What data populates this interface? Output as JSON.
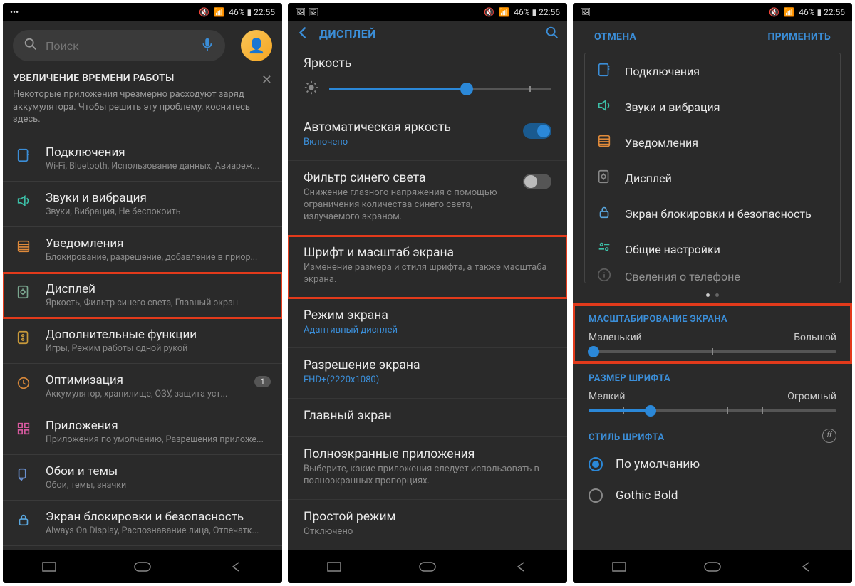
{
  "screen1": {
    "status": {
      "left_icons": "•••",
      "right": "46% ▮ 22:55"
    },
    "search_placeholder": "Поиск",
    "tip": {
      "title": "УВЕЛИЧЕНИЕ ВРЕМЕНИ РАБОТЫ",
      "body": "Некоторые приложения чрезмерно расходуют заряд аккумулятора. Чтобы решить эту проблему, коснитесь здесь."
    },
    "items": [
      {
        "icon": "connections",
        "title": "Подключения",
        "sub": "Wi-Fi, Bluetooth, Использование данных, Авиареж...",
        "hl": false
      },
      {
        "icon": "sound",
        "title": "Звуки и вибрация",
        "sub": "Звуки, Вибрация, Не беспокоить",
        "hl": false
      },
      {
        "icon": "notif",
        "title": "Уведомления",
        "sub": "Блокирование, разрешение, добавление в приор...",
        "hl": false
      },
      {
        "icon": "display",
        "title": "Дисплей",
        "sub": "Яркость, Фильтр синего света, Главный экран",
        "hl": true
      },
      {
        "icon": "advanced",
        "title": "Дополнительные функции",
        "sub": "Игры, Режим работы одной рукой",
        "hl": false
      },
      {
        "icon": "optim",
        "title": "Оптимизация",
        "sub": "Аккумулятор, хранилище, ОЗУ, защита уст...",
        "hl": false,
        "badge": "1"
      },
      {
        "icon": "apps",
        "title": "Приложения",
        "sub": "Приложения по умолчанию, Разрешения приложе...",
        "hl": false
      },
      {
        "icon": "wallpaper",
        "title": "Обои и темы",
        "sub": "Обои, темы, значки",
        "hl": false
      },
      {
        "icon": "lock",
        "title": "Экран блокировки и безопасность",
        "sub": "Always On Display, Распознавание лица, Отпечатк...",
        "hl": false
      }
    ]
  },
  "screen2": {
    "status": {
      "right": "46% ▮ 22:56"
    },
    "appbar_title": "ДИСПЛЕЙ",
    "brightness": {
      "title": "Яркость",
      "value": 62
    },
    "auto_bright": {
      "title": "Автоматическая яркость",
      "sub": "Включено",
      "on": true
    },
    "blue_filter": {
      "title": "Фильтр синего света",
      "sub": "Снижение глазного напряжения с помощью ограничения количества синего света, излучаемого экраном.",
      "on": false
    },
    "font_scale": {
      "title": "Шрифт и масштаб экрана",
      "sub": "Изменение размера и стиля шрифта, а также масштаба экрана."
    },
    "screen_mode": {
      "title": "Режим экрана",
      "sub": "Адаптивный дисплей"
    },
    "resolution": {
      "title": "Разрешение экрана",
      "sub": "FHD+(2220x1080)"
    },
    "home": {
      "title": "Главный экран"
    },
    "fullscreen": {
      "title": "Полноэкранные приложения",
      "sub": "Выберите, какие приложения следует использовать в полноэкранных пропорциях."
    },
    "simple": {
      "title": "Простой режим",
      "sub": "Отключено"
    }
  },
  "screen3": {
    "status": {
      "right": "46% ▮ 22:56"
    },
    "cancel": "ОТМЕНА",
    "apply": "ПРИМЕНИТЬ",
    "cats": [
      {
        "icon": "connections",
        "label": "Подключения",
        "color": "#3b8ed8"
      },
      {
        "icon": "sound",
        "label": "Звуки и вибрация",
        "color": "#3cc0a8"
      },
      {
        "icon": "notif",
        "label": "Уведомления",
        "color": "#e08a3a"
      },
      {
        "icon": "display",
        "label": "Дисплей",
        "color": "#888"
      },
      {
        "icon": "lock",
        "label": "Экран блокировки и безопасность",
        "color": "#5aa8e0"
      },
      {
        "icon": "general",
        "label": "Общие настройки",
        "color": "#3cc0a8"
      },
      {
        "icon": "about",
        "label": "Свеления о телефоне",
        "color": "#888"
      }
    ],
    "scale": {
      "head": "МАСШТАБИРОВАНИЕ ЭКРАНА",
      "min": "Маленький",
      "max": "Большой",
      "value": 2
    },
    "font": {
      "head": "РАЗМЕР ШРИФТА",
      "min": "Мелкий",
      "max": "Огромный",
      "value": 25
    },
    "style": {
      "head": "СТИЛЬ ШРИФТА",
      "options": [
        {
          "label": "По умолчанию",
          "sel": true
        },
        {
          "label": "Gothic Bold",
          "sel": false
        }
      ]
    }
  }
}
